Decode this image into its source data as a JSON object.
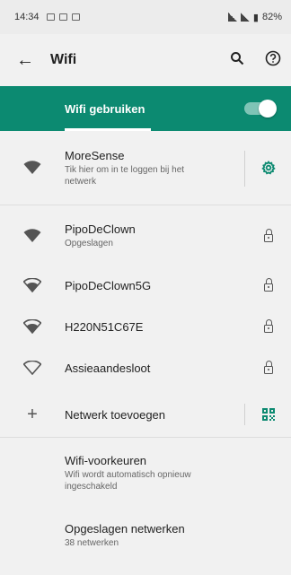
{
  "status_bar": {
    "time": "14:34",
    "battery": "82%"
  },
  "app_bar": {
    "title": "Wifi"
  },
  "wifi_toggle": {
    "label": "Wifi gebruiken",
    "enabled": true,
    "accent": "#0c8a71"
  },
  "connected": {
    "ssid": "MoreSense",
    "subtitle": "Tik hier om in te loggen bij het netwerk",
    "icon": "wifi-full-icon"
  },
  "networks": [
    {
      "ssid": "PipoDeClown",
      "subtitle": "Opgeslagen",
      "icon": "wifi-full-icon",
      "locked": true
    },
    {
      "ssid": "PipoDeClown5G",
      "subtitle": "",
      "icon": "wifi-strong-icon",
      "locked": true
    },
    {
      "ssid": "H220N51C67E",
      "subtitle": "",
      "icon": "wifi-strong-icon",
      "locked": true
    },
    {
      "ssid": "Assieaandesloot",
      "subtitle": "",
      "icon": "wifi-empty-icon",
      "locked": true
    }
  ],
  "add_network": {
    "label": "Netwerk toevoegen"
  },
  "preferences": {
    "title": "Wifi-voorkeuren",
    "subtitle": "Wifi wordt automatisch opnieuw ingeschakeld"
  },
  "saved_networks": {
    "title": "Opgeslagen netwerken",
    "subtitle": "38 netwerken"
  }
}
